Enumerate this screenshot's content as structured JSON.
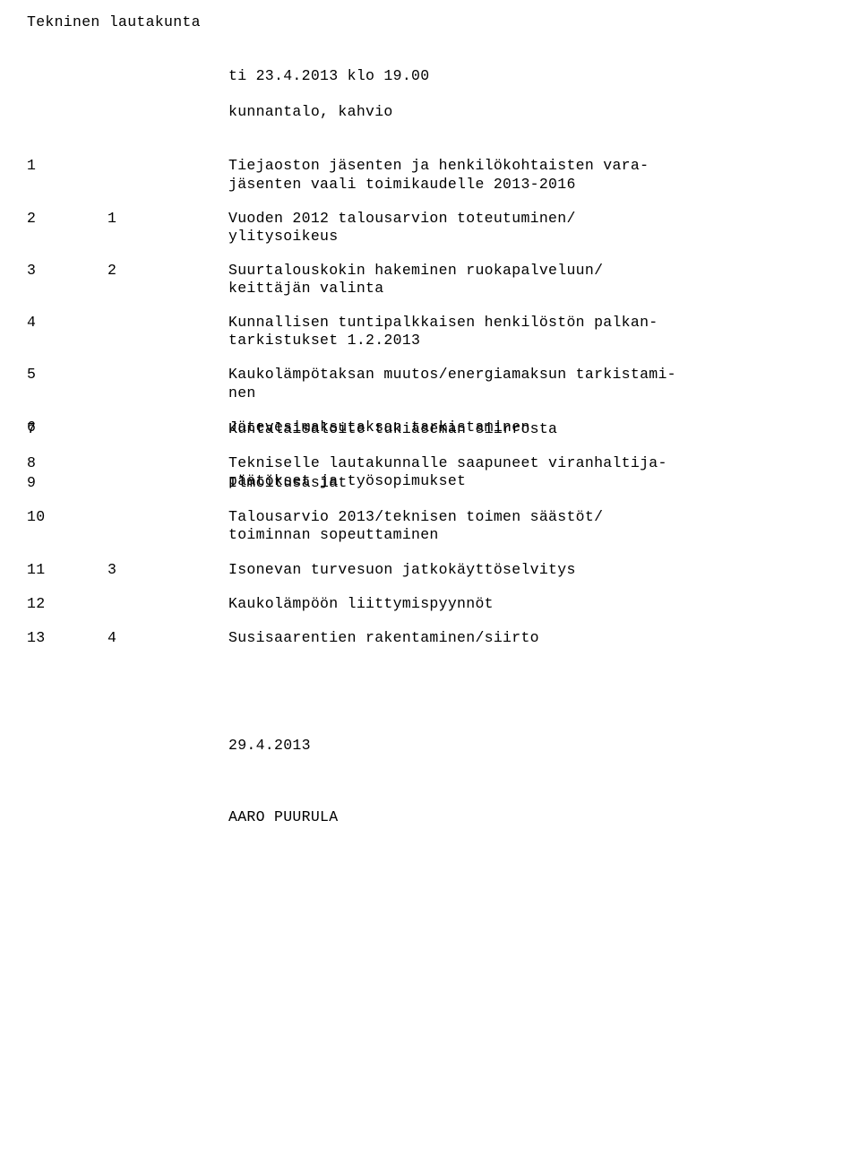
{
  "header": {
    "title": "Tekninen lautakunta",
    "meeting_time": "ti 23.4.2013 klo 19.00",
    "meeting_place": "kunnantalo, kahvio"
  },
  "items": [
    {
      "num": "1",
      "sub": "",
      "text": "Tiejaoston jäsenten ja henkilökohtaisten vara-\njäsenten vaali toimikaudelle 2013-2016"
    },
    {
      "num": "2",
      "sub": "1",
      "text": "Vuoden 2012 talousarvion toteutuminen/\nylitysoikeus"
    },
    {
      "num": "3",
      "sub": "2",
      "text": "Suurtalouskokin hakeminen ruokapalveluun/\nkeittäjän valinta"
    },
    {
      "num": "4",
      "sub": "",
      "text": "Kunnallisen tuntipalkkaisen henkilöstön palkan-\ntarkistukset 1.2.2013"
    },
    {
      "num": "5",
      "sub": "",
      "text": "Kaukolämpötaksan muutos/energiamaksun tarkistami-\nnen"
    },
    {
      "num": "6",
      "sub": "",
      "text": "Jätevesimaksutaksan tarkistaminen"
    },
    {
      "num": "7",
      "sub": "",
      "text": "Kuntalaisaloite tukiaseman siirrosta"
    },
    {
      "num": "8",
      "sub": "",
      "text": "Tekniselle lautakunnalle saapuneet viranhaltija-\npäätökset ja työsopimukset"
    },
    {
      "num": "9",
      "sub": "",
      "text": "Ilmoitusasiat"
    },
    {
      "num": "10",
      "sub": "",
      "text": "Talousarvio 2013/teknisen toimen säästöt/\ntoiminnan sopeuttaminen"
    },
    {
      "num": "11",
      "sub": "3",
      "text": "Isonevan turvesuon jatkokäyttöselvitys"
    },
    {
      "num": "12",
      "sub": "",
      "text": "Kaukolämpöön liittymispyynnöt"
    },
    {
      "num": "13",
      "sub": "4",
      "text": "Susisaarentien rakentaminen/siirto"
    }
  ],
  "footer": {
    "date": "29.4.2013",
    "signature": "AARO PUURULA"
  },
  "gap_after": {
    "6": -18,
    "8": -18
  }
}
